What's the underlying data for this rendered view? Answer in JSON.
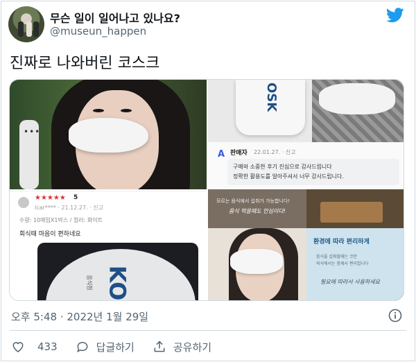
{
  "author": {
    "display_name": "무슨 일이 일어나고 있나요?",
    "handle": "@museun_happen"
  },
  "tweet": {
    "text": "진짜로 나와버린 코스크",
    "timestamp": "오후 5:48 · 2022년 1월 29일"
  },
  "media": {
    "seller_reply": {
      "name": "판매자",
      "meta": "22.01.27. · 신고",
      "line1": "구매와 소중한 후기 진심으로 감사드립니다",
      "line2": "정확한 활용도를 알아주셔서 너무 감사드립니다."
    },
    "review": {
      "stars": "★★★★★",
      "rating": "5",
      "reviewer": "lcar**** · 21.12.27. · 신고",
      "option": "수량: 10매입X1박스 / 컬러: 화이트",
      "comment": "회식때 마음이 편하네요"
    },
    "product_box_text": "OSK",
    "product_brand": "KO",
    "product_small": "음식점",
    "story": {
      "card1_line": "모르는 음식에서 섭취가 가능합니다!",
      "card1_hand": "음식 먹을때도 안심이다!",
      "card4_title": "환경에 따라 편리하게",
      "card4_sub": "음식을 섭취할때는 코만",
      "card4_sub2": "외식에서는 함께사 편리합니다",
      "card4_hand": "필요에 따라서 사용하세요"
    }
  },
  "actions": {
    "like_count": "433",
    "reply_label": "답글하기",
    "share_label": "공유하기"
  },
  "colors": {
    "twitter_blue": "#1d9bf0",
    "secondary_text": "#536471",
    "primary_text": "#0f1419",
    "border": "#cfd9de"
  },
  "icons": [
    "twitter-bird-icon",
    "info-icon",
    "heart-icon",
    "reply-icon",
    "share-icon"
  ]
}
